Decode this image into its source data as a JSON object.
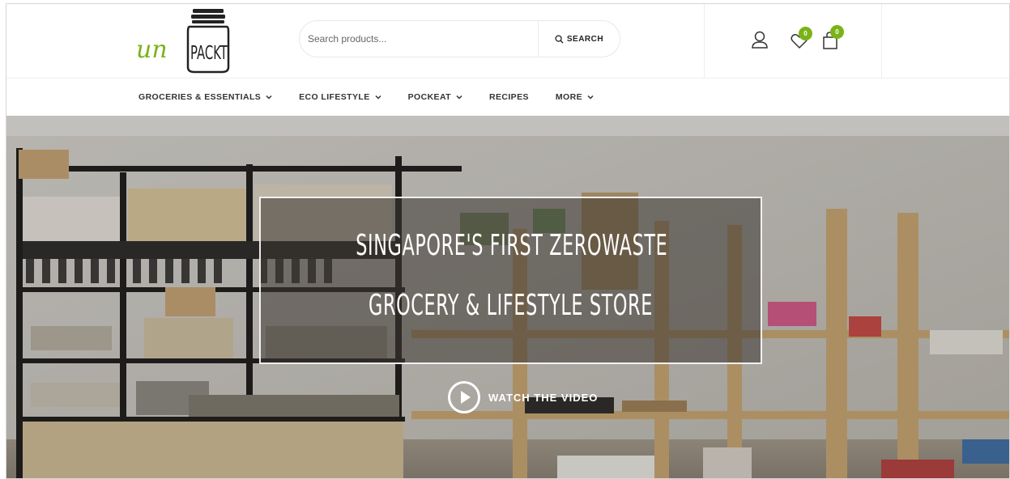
{
  "brand": {
    "logo_text": "unPACKT",
    "logo_prefix": "un",
    "logo_suffix": "PACKT",
    "accent_color": "#7ab317"
  },
  "search": {
    "placeholder": "Search products...",
    "button_label": "SEARCH",
    "button_icon": "search-icon"
  },
  "header_icons": [
    {
      "name": "account-icon"
    },
    {
      "name": "wishlist-heart-icon",
      "badge": "0"
    },
    {
      "name": "cart-bag-icon",
      "badge": "0"
    }
  ],
  "nav": [
    {
      "label": "GROCERIES & ESSENTIALS",
      "has_dropdown": true
    },
    {
      "label": "ECO LIFESTYLE",
      "has_dropdown": true
    },
    {
      "label": "POCKEAT",
      "has_dropdown": true
    },
    {
      "label": "RECIPES",
      "has_dropdown": false
    },
    {
      "label": "MORE",
      "has_dropdown": true
    }
  ],
  "hero": {
    "headline_line1": "SINGAPORE'S FIRST ZEROWASTE",
    "headline_line2": "GROCERY & LIFESTYLE STORE",
    "cta_label": "WATCH THE VIDEO",
    "cta_icon": "play-circle-icon"
  }
}
